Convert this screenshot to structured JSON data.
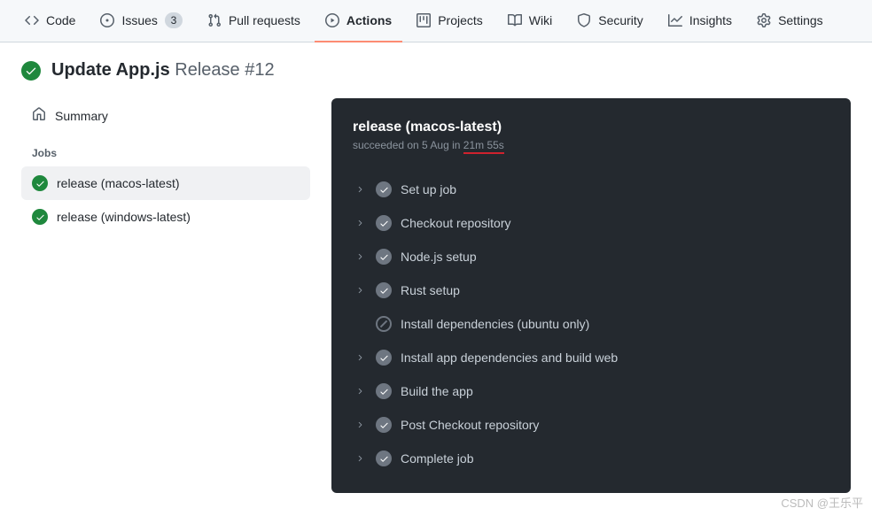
{
  "tabs": {
    "code": "Code",
    "issues": "Issues",
    "issues_count": "3",
    "pulls": "Pull requests",
    "actions": "Actions",
    "projects": "Projects",
    "wiki": "Wiki",
    "security": "Security",
    "insights": "Insights",
    "settings": "Settings"
  },
  "header": {
    "title": "Update App.js",
    "suffix": "Release #12"
  },
  "sidebar": {
    "summary": "Summary",
    "jobs_label": "Jobs",
    "job1": "release (macos-latest)",
    "job2": "release (windows-latest)"
  },
  "main": {
    "title": "release (macos-latest)",
    "sub_prefix": "succeeded on 5 Aug in ",
    "duration": "21m 55s",
    "steps": [
      {
        "label": "Set up job",
        "status": "success"
      },
      {
        "label": "Checkout repository",
        "status": "success"
      },
      {
        "label": "Node.js setup",
        "status": "success"
      },
      {
        "label": "Rust setup",
        "status": "success"
      },
      {
        "label": "Install dependencies (ubuntu only)",
        "status": "skipped"
      },
      {
        "label": "Install app dependencies and build web",
        "status": "success"
      },
      {
        "label": "Build the app",
        "status": "success"
      },
      {
        "label": "Post Checkout repository",
        "status": "success"
      },
      {
        "label": "Complete job",
        "status": "success"
      }
    ]
  },
  "watermark": "CSDN @王乐平"
}
